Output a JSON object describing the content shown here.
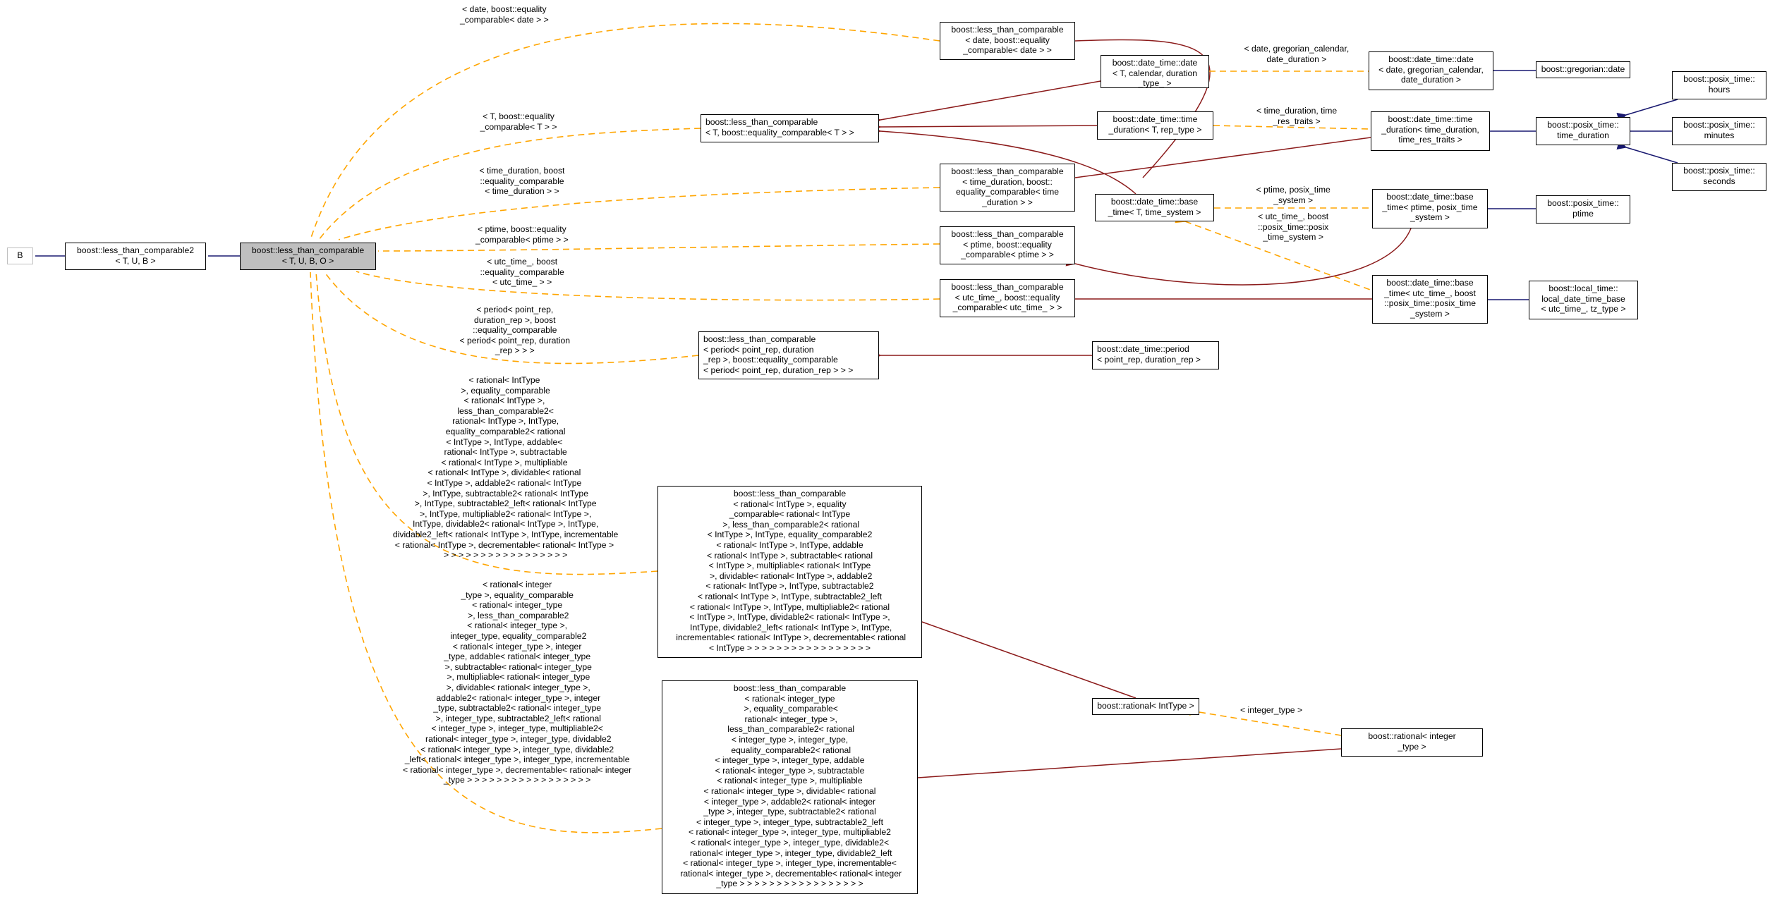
{
  "diagram": {
    "kind": "doxygen-inheritance-graph",
    "colors": {
      "public_inheritance": "#191970",
      "template_instance": "#ffa500",
      "protected_or_related": "#8b1a1a",
      "focus_node_fill": "#bfbfbf"
    },
    "nodes": {
      "b": "B",
      "ltc2": "boost::less_than_comparable2\n< T, U, B >",
      "ltc": "boost::less_than_comparable\n< T, U, B, O >",
      "ltc_date": "boost::less_than_comparable\n< date, boost::equality\n_comparable< date > >",
      "ltc_t": "boost::less_than_comparable\n< T, boost::equality_comparable< T > >",
      "ltc_td": "boost::less_than_comparable\n< time_duration, boost::\nequality_comparable< time\n_duration > >",
      "ltc_ptime": "boost::less_than_comparable\n< ptime, boost::equality\n_comparable< ptime > >",
      "ltc_utc": "boost::less_than_comparable\n< utc_time_, boost::equality\n_comparable< utc_time_ > >",
      "ltc_period": "boost::less_than_comparable\n< period< point_rep, duration\n_rep >, boost::equality_comparable\n< period< point_rep, duration_rep > > >",
      "ltc_rat_int": "boost::less_than_comparable\n< rational< IntType >, equality\n_comparable< rational< IntType\n >, less_than_comparable2< rational\n< IntType >, IntType, equality_comparable2\n< rational< IntType >, IntType, addable\n< rational< IntType >, subtractable< rational\n< IntType >, multipliable< rational< IntType\n >, dividable< rational< IntType >, addable2\n< rational< IntType >, IntType, subtractable2\n< rational< IntType >, IntType, subtractable2_left\n< rational< IntType >, IntType, multipliable2< rational\n< IntType >, IntType, dividable2< rational< IntType >,\n IntType, dividable2_left< rational< IntType >, IntType,\n incrementable< rational< IntType >, decrementable< rational\n< IntType > > > > > > > > > > > > > > > > >",
      "ltc_rat_integer": "boost::less_than_comparable\n< rational< integer_type\n >, equality_comparable<\n rational< integer_type >,\n less_than_comparable2< rational\n< integer_type >, integer_type,\n equality_comparable2< rational\n< integer_type >, integer_type, addable\n< rational< integer_type >, subtractable\n< rational< integer_type >, multipliable\n< rational< integer_type >, dividable< rational\n< integer_type >, addable2< rational< integer\n_type >, integer_type, subtractable2< rational\n< integer_type >, integer_type, subtractable2_left\n< rational< integer_type >, integer_type, multipliable2\n< rational< integer_type >, integer_type, dividable2<\n rational< integer_type >, integer_type, dividable2_left\n< rational< integer_type >, integer_type, incrementable<\n rational< integer_type >, decrementable< rational< integer\n_type > > > > > > > > > > > > > > > > >",
      "dt_date_t": "boost::date_time::date\n< T, calendar, duration\n_type_ >",
      "dt_td_t": "boost::date_time::time\n_duration< T, rep_type >",
      "dt_base_t": "boost::date_time::base\n_time< T, time_system >",
      "dt_period": "boost::date_time::period\n< point_rep, duration_rep >",
      "rational_int": "boost::rational< IntType >",
      "dt_date_greg": "boost::date_time::date\n< date, gregorian_calendar,\ndate_duration >",
      "dt_td_inst": "boost::date_time::time\n_duration< time_duration,\ntime_res_traits >",
      "dt_base_ptime": "boost::date_time::base\n_time< ptime, posix_time\n_system >",
      "dt_base_utc": "boost::date_time::base\n_time< utc_time_, boost\n::posix_time::posix_time\n_system >",
      "rational_integer": "boost::rational< integer\n_type >",
      "greg_date": "boost::gregorian::date",
      "pt_td": "boost::posix_time::\ntime_duration",
      "pt_ptime": "boost::posix_time::\nptime",
      "lt_ldtb": "boost::local_time::\nlocal_date_time_base\n< utc_time_, tz_type >",
      "pt_hours": "boost::posix_time::\nhours",
      "pt_minutes": "boost::posix_time::\nminutes",
      "pt_seconds": "boost::posix_time::\nseconds"
    },
    "edge_labels": {
      "date": "< date, boost::equality\n_comparable< date > >",
      "t": "< T, boost::equality\n_comparable< T > >",
      "td": "< time_duration, boost\n::equality_comparable\n< time_duration > >",
      "ptime": "< ptime, boost::equality\n_comparable< ptime > >",
      "utc": "< utc_time_, boost\n::equality_comparable\n< utc_time_ > >",
      "period": "< period< point_rep,\nduration_rep >, boost\n::equality_comparable\n< period< point_rep, duration\n_rep > > >",
      "rat_int": "< rational< IntType\n >, equality_comparable\n< rational< IntType >,\n less_than_comparable2<\n rational< IntType >, IntType,\n equality_comparable2< rational\n< IntType >, IntType, addable<\n rational< IntType >, subtractable\n< rational< IntType >, multipliable\n< rational< IntType >, dividable< rational\n< IntType >, addable2< rational< IntType\n >, IntType, subtractable2< rational< IntType\n >, IntType, subtractable2_left< rational< IntType\n >, IntType, multipliable2< rational< IntType >,\n IntType, dividable2< rational< IntType >, IntType,\n dividable2_left< rational< IntType >, IntType, incrementable\n< rational< IntType >, decrementable< rational< IntType >\n > > > > > > > > > > > > > > > > >",
      "rat_integer": "< rational< integer\n_type >, equality_comparable\n< rational< integer_type\n >, less_than_comparable2\n< rational< integer_type >,\n integer_type, equality_comparable2\n< rational< integer_type >, integer\n_type, addable< rational< integer_type\n >, subtractable< rational< integer_type\n >, multipliable< rational< integer_type\n >, dividable< rational< integer_type >,\n addable2< rational< integer_type >, integer\n_type, subtractable2< rational< integer_type\n >, integer_type, subtractable2_left< rational\n< integer_type >, integer_type, multipliable2<\n rational< integer_type >, integer_type, dividable2\n< rational< integer_type >, integer_type, dividable2\n_left< rational< integer_type >, integer_type, incrementable\n< rational< integer_type >, decrementable< rational< integer\n_type > > > > > > > > > > > > > > > > >",
      "date_greg": "< date, gregorian_calendar,\ndate_duration >",
      "td_inst": "< time_duration, time\n_res_traits >",
      "ptime_inst": "< ptime, posix_time\n_system >",
      "utc_inst": "< utc_time_, boost\n::posix_time::posix\n_time_system >",
      "integer_type": "< integer_type >"
    }
  }
}
